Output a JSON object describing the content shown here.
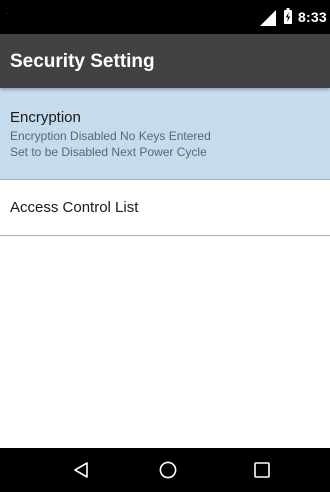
{
  "status_bar": {
    "time": "8:33",
    "icons": [
      "signal-icon",
      "battery-charging-icon"
    ]
  },
  "app_bar": {
    "title": "Security Setting",
    "background": "#424242"
  },
  "list": {
    "items": [
      {
        "title": "Encryption",
        "summary_line_1": "Encryption Disabled No Keys Entered",
        "summary_line_2": "Set to be Disabled Next Power Cycle",
        "highlighted": true,
        "highlight_color": "#c5dcef"
      },
      {
        "title": "Access Control List",
        "highlighted": false
      }
    ],
    "divider_color": "#8db8d8"
  },
  "nav_bar": {
    "buttons": [
      "back-icon",
      "home-icon",
      "recents-icon"
    ]
  }
}
